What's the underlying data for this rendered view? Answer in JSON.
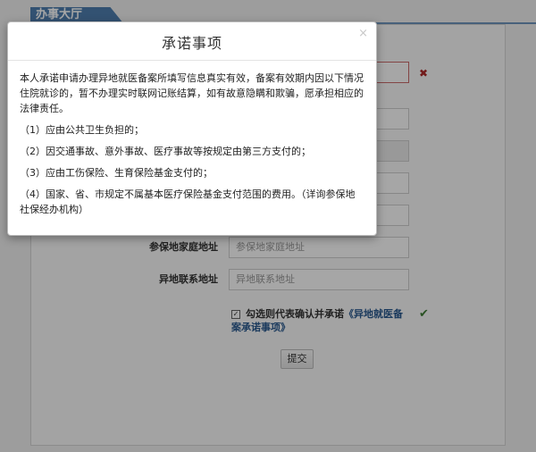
{
  "hall_title": "办事大厅",
  "form": {
    "address_label": "参保地家庭地址",
    "address_placeholder": "参保地家庭地址",
    "contact_label": "异地联系地址",
    "contact_placeholder": "异地联系地址",
    "agree_text": "勾选则代表确认并承诺",
    "agree_link": "《异地就医备案承诺事项》",
    "submit_label": "提交",
    "error_icon": "✖",
    "ok_icon": "✔"
  },
  "modal": {
    "title": "承诺事项",
    "close": "×",
    "intro": "本人承诺申请办理异地就医备案所填写信息真实有效，备案有效期内因以下情况住院就诊的，暂不办理实时联网记账结算，如有故意隐瞒和欺骗，愿承担相应的法律责任。",
    "items": [
      "（1）应由公共卫生负担的；",
      "（2）因交通事故、意外事故、医疗事故等按规定由第三方支付的；",
      "（3）应由工伤保险、生育保险基金支付的；",
      "（4）国家、省、市规定不属基本医疗保险基金支付范围的费用。（详询参保地社保经办机构）"
    ]
  }
}
